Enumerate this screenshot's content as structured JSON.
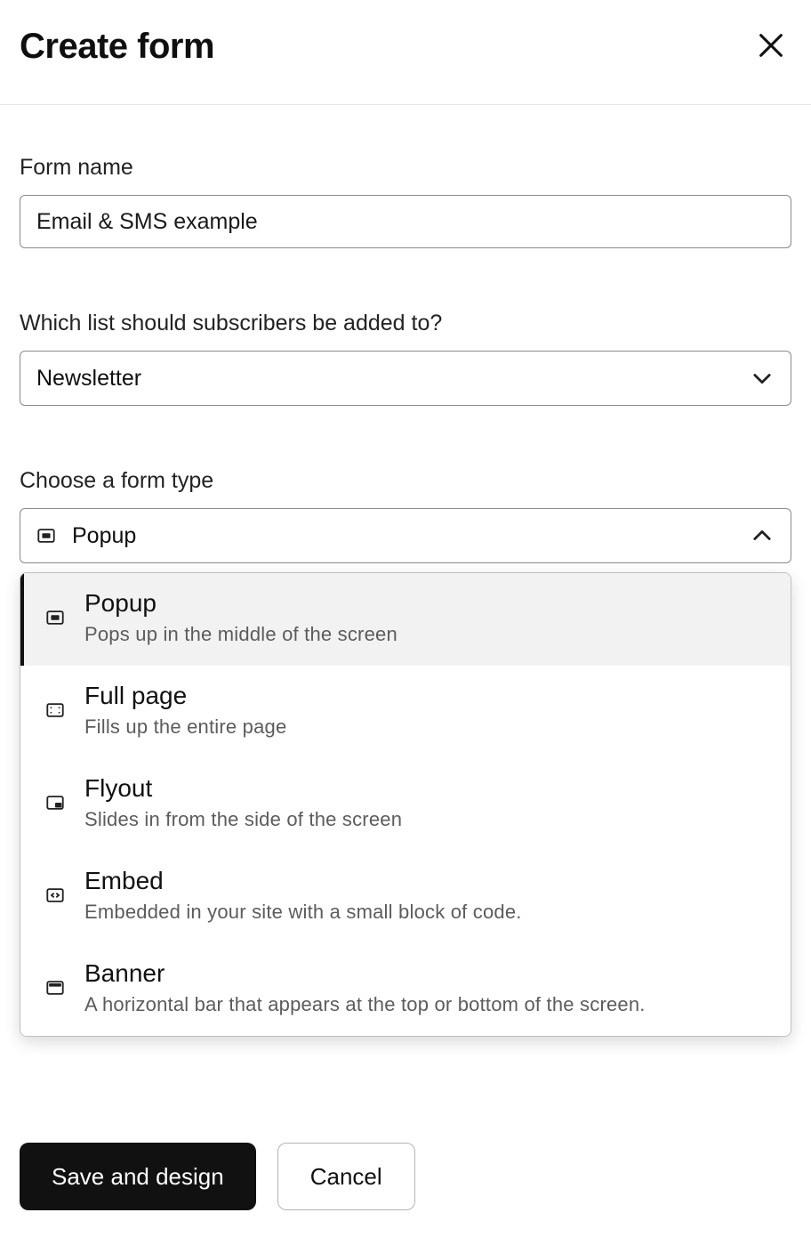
{
  "header": {
    "title": "Create form"
  },
  "fields": {
    "form_name": {
      "label": "Form name",
      "value": "Email & SMS example"
    },
    "list_select": {
      "label": "Which list should subscribers be added to?",
      "value": "Newsletter"
    },
    "form_type": {
      "label": "Choose a form type",
      "value": "Popup",
      "options": [
        {
          "id": "popup",
          "title": "Popup",
          "desc": "Pops up in the middle of the screen",
          "selected": true
        },
        {
          "id": "fullpage",
          "title": "Full page",
          "desc": "Fills up the entire page",
          "selected": false
        },
        {
          "id": "flyout",
          "title": "Flyout",
          "desc": "Slides in from the side of the screen",
          "selected": false
        },
        {
          "id": "embed",
          "title": "Embed",
          "desc": "Embedded in your site with a small block of code.",
          "selected": false
        },
        {
          "id": "banner",
          "title": "Banner",
          "desc": "A horizontal bar that appears at the top or bottom of the screen.",
          "selected": false
        }
      ]
    }
  },
  "footer": {
    "primary": "Save and design",
    "secondary": "Cancel"
  }
}
